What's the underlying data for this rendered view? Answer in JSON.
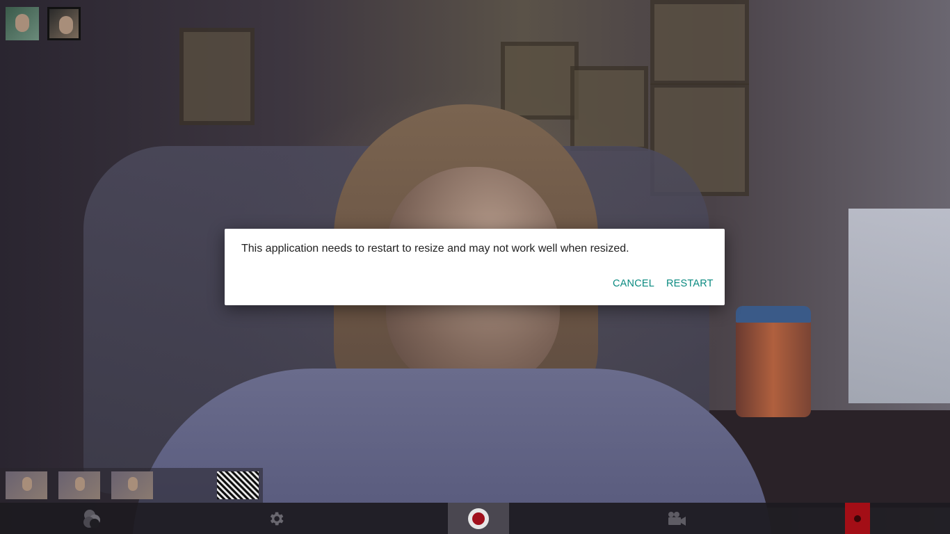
{
  "dialog": {
    "message": "This application needs to restart to resize and may not work well when resized.",
    "cancel_label": "CANCEL",
    "restart_label": "RESTART"
  },
  "toolbar": {
    "icons": [
      "effects-icon",
      "settings-icon",
      "record-icon",
      "video-camera-icon",
      "recording-indicator-icon"
    ]
  },
  "colors": {
    "accent": "#0a8a80",
    "record": "#a0101c",
    "indicator": "#a30e16"
  }
}
